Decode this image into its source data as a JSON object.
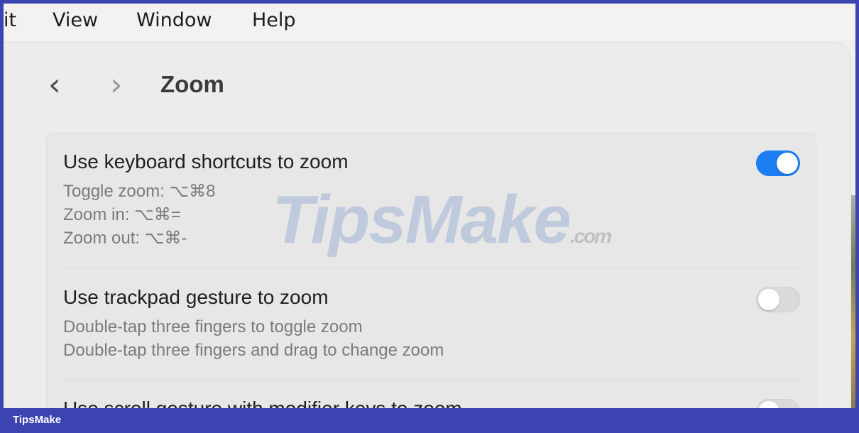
{
  "menubar": {
    "items": [
      "it",
      "View",
      "Window",
      "Help"
    ]
  },
  "nav": {
    "back_glyph": "‹",
    "forward_glyph": "›"
  },
  "window": {
    "title": "Zoom"
  },
  "settings": [
    {
      "title": "Use keyboard shortcuts to zoom",
      "desc": [
        "Toggle zoom: ⌥⌘8",
        "Zoom in: ⌥⌘=",
        "Zoom out: ⌥⌘-"
      ],
      "enabled": true
    },
    {
      "title": "Use trackpad gesture to zoom",
      "desc": [
        "Double-tap three fingers to toggle zoom",
        "Double-tap three fingers and drag to change zoom"
      ],
      "enabled": false
    },
    {
      "title": "Use scroll gesture with modifier keys to zoom",
      "desc": [],
      "enabled": false
    }
  ],
  "watermark": {
    "text": "TipsMake",
    "suffix": ".com"
  },
  "footer": {
    "brand": "TipsMake"
  },
  "colors": {
    "toggle_on": "#1c7ef2",
    "frame": "#3b44b0"
  }
}
